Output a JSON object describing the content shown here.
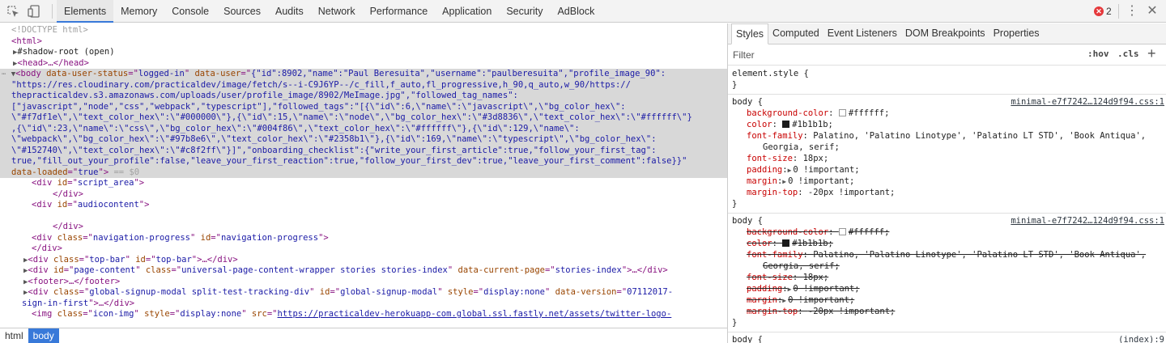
{
  "toolbar": {
    "tabs": [
      "Elements",
      "Memory",
      "Console",
      "Sources",
      "Audits",
      "Network",
      "Performance",
      "Application",
      "Security",
      "AdBlock"
    ],
    "active_tab": "Elements",
    "error_count": "2"
  },
  "dom": {
    "doctype": "<!DOCTYPE html>",
    "html_open": "<html>",
    "shadow_root": "#shadow-root (open)",
    "head": "<head>…</head>",
    "body_status_value": "logged-in",
    "body_user_line1": "{\"id\":8902,\"name\":\"Paul Beresuita\",\"username\":\"paulberesuita\",\"profile_image_90\":",
    "body_user_line2": "\"https://res.cloudinary.com/practicaldev/image/fetch/s--i-C9J6YP--/c_fill,f_auto,fl_progressive,h_90,q_auto,w_90/https://",
    "body_user_line3": "thepracticaldev.s3.amazonaws.com/uploads/user/profile_image/8902/MeImage.jpg\",\"followed_tag_names\":",
    "body_user_line4": "[\"javascript\",\"node\",\"css\",\"webpack\",\"typescript\"],\"followed_tags\":\"[{\\\"id\\\":6,\\\"name\\\":\\\"javascript\\\",\\\"bg_color_hex\\\":",
    "body_user_line5": "\\\"#f7df1e\\\",\\\"text_color_hex\\\":\\\"#000000\\\"},{\\\"id\\\":15,\\\"name\\\":\\\"node\\\",\\\"bg_color_hex\\\":\\\"#3d8836\\\",\\\"text_color_hex\\\":\\\"#ffffff\\\"}",
    "body_user_line6": ",{\\\"id\\\":23,\\\"name\\\":\\\"css\\\",\\\"bg_color_hex\\\":\\\"#004f86\\\",\\\"text_color_hex\\\":\\\"#ffffff\\\"},{\\\"id\\\":129,\\\"name\\\":",
    "body_user_line7": "\\\"webpack\\\",\\\"bg_color_hex\\\":\\\"#97b8e6\\\",\\\"text_color_hex\\\":\\\"#2358b1\\\"},{\\\"id\\\":169,\\\"name\\\":\\\"typescript\\\",\\\"bg_color_hex\\\":",
    "body_user_line8": "\\\"#152740\\\",\\\"text_color_hex\\\":\\\"#c8f2ff\\\"}]\",\"onboarding_checklist\":{\"write_your_first_article\":true,\"follow_your_first_tag\":",
    "body_user_line9": "true,\"fill_out_your_profile\":false,\"leave_your_first_reaction\":true,\"follow_your_first_dev\":true,\"leave_your_first_comment\":false}}\"",
    "body_loaded_value": "true",
    "body_eq": "== $0",
    "script_area_id": "script_area",
    "audiocontent_id": "audiocontent",
    "navprog_class": "navigation-progress",
    "navprog_id": "navigation-progress",
    "topbar_class": "top-bar",
    "topbar_id": "top-bar",
    "pagecontent_id": "page-content",
    "pagecontent_class": "universal-page-content-wrapper stories stories-index",
    "pagecontent_page": "stories-index",
    "footer": "<footer>…</footer>",
    "signup_class": "global-signup-modal split-test-tracking-div",
    "signup_id": "global-signup-modal",
    "signup_style": "display:none",
    "signup_version_a": "07112017-",
    "signup_version_b": "sign-in-first",
    "img_class": "icon-img",
    "img_style": "display:none",
    "img_src": "https://practicaldev-herokuapp-com.global.ssl.fastly.net/assets/twitter-logo-"
  },
  "breadcrumb": [
    "html",
    "body"
  ],
  "styles": {
    "tabs": [
      "Styles",
      "Computed",
      "Event Listeners",
      "DOM Breakpoints",
      "Properties"
    ],
    "active_tab": "Styles",
    "filter_placeholder": "Filter",
    "hov": ":hov",
    "cls": ".cls",
    "plus": "+",
    "element_style": "element.style {",
    "rule1": {
      "selector": "body {",
      "source": "minimal-e7f7242…124d9f94.css:1",
      "bg": "#ffffff",
      "color": "#1b1b1b",
      "font_family_a": "Palatino, 'Palatino Linotype', 'Palatino LT STD', 'Book Antiqua',",
      "font_family_b": "Georgia, serif;",
      "font_size": "18px;",
      "padding": "0 !important;",
      "margin": "0 !important;",
      "margin_top": "-20px !important;"
    },
    "rule3": {
      "selector": "body {",
      "source": "(index):9"
    }
  }
}
